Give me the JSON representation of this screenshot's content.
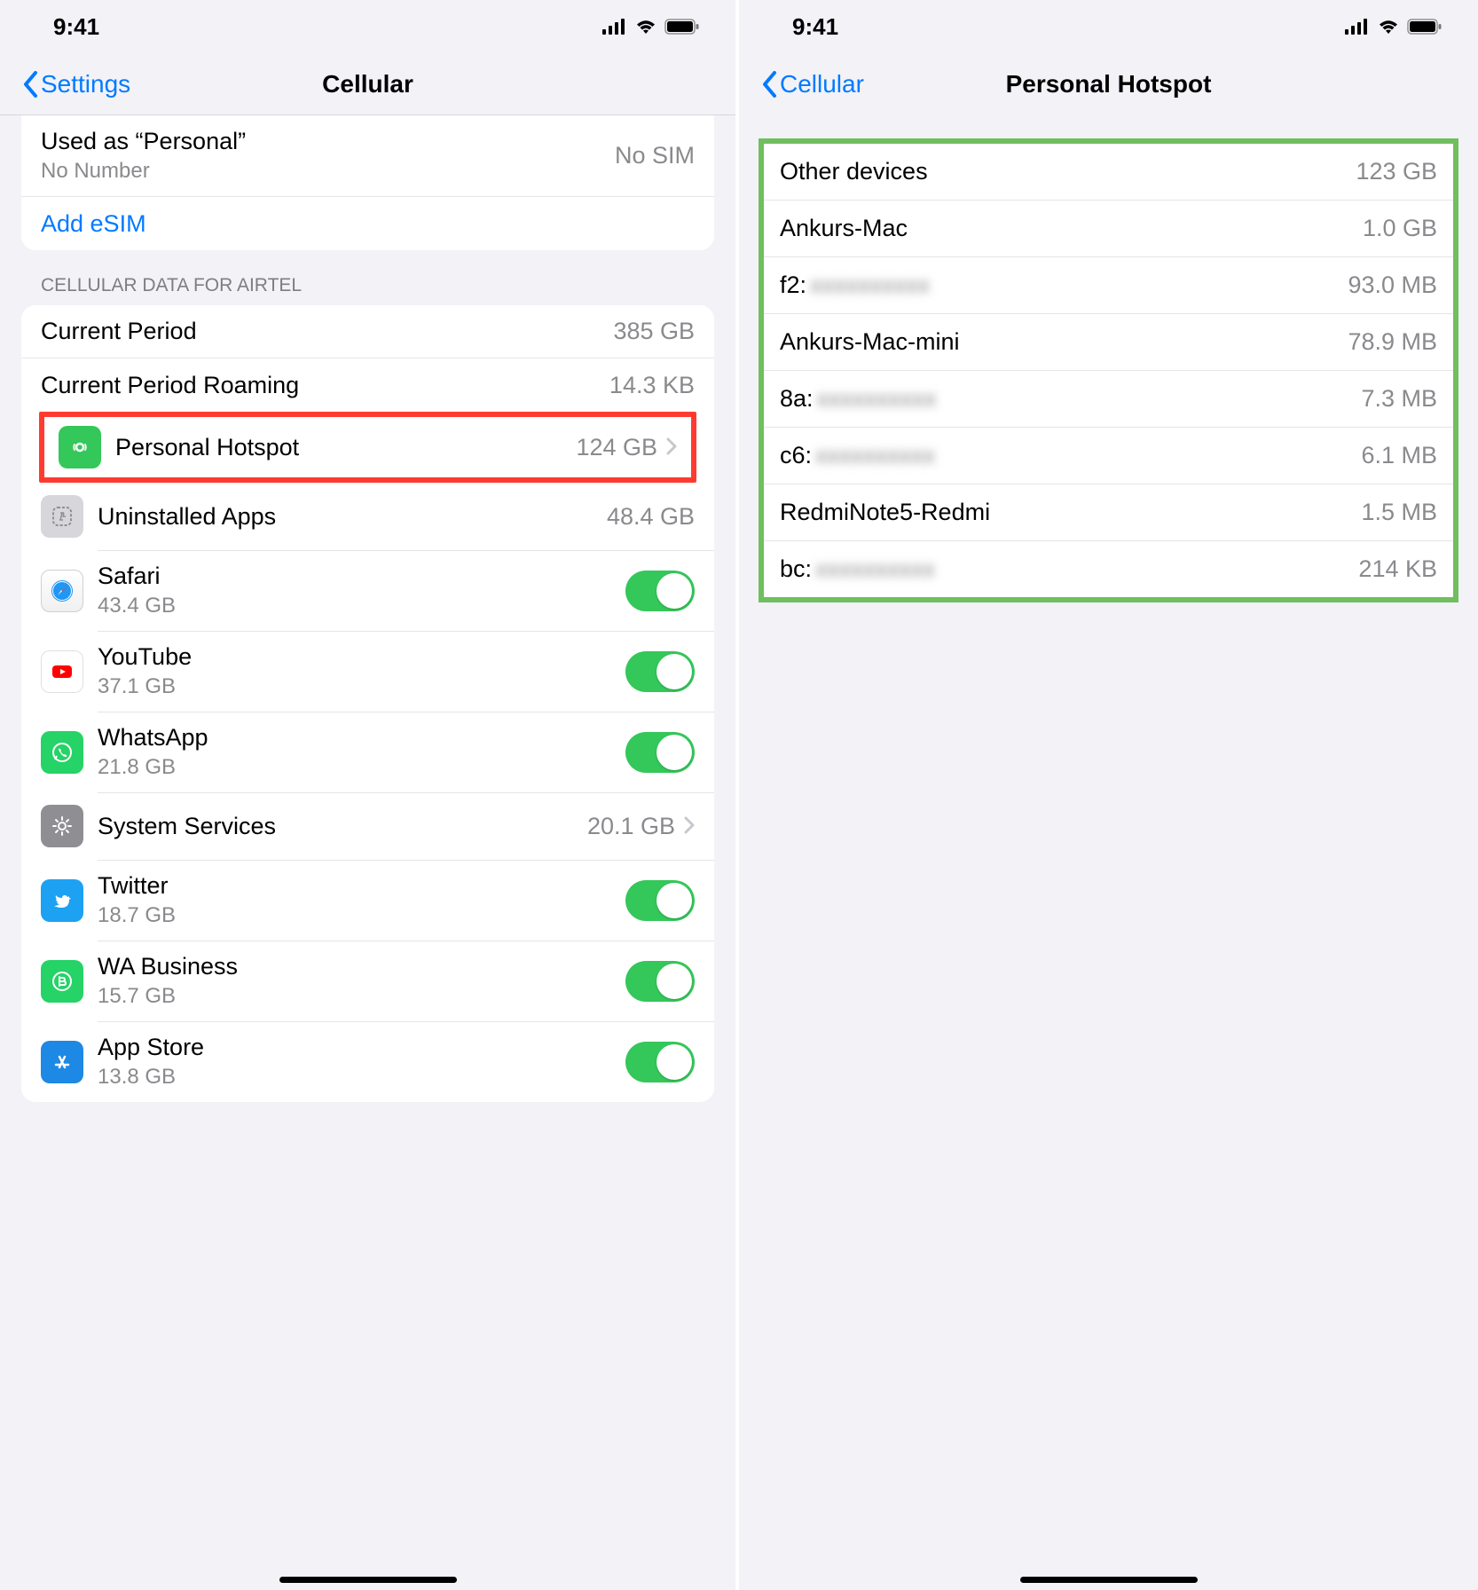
{
  "statusBar": {
    "time": "9:41"
  },
  "left": {
    "back": "Settings",
    "title": "Cellular",
    "sim": {
      "label": "Used as “Personal”",
      "sub": "No Number",
      "state": "No SIM",
      "addEsim": "Add eSIM"
    },
    "dataSectionHeader": "CELLULAR DATA FOR AIRTEL",
    "currentPeriod": {
      "label": "Current Period",
      "value": "385 GB"
    },
    "currentPeriodRoaming": {
      "label": "Current Period Roaming",
      "value": "14.3 KB"
    },
    "hotspot": {
      "label": "Personal Hotspot",
      "value": "124 GB"
    },
    "uninstalled": {
      "label": "Uninstalled Apps",
      "value": "48.4 GB"
    },
    "systemServices": {
      "label": "System Services",
      "value": "20.1 GB"
    },
    "apps": [
      {
        "name": "Safari",
        "usage": "43.4 GB",
        "iconClass": "ic-safari",
        "iconName": "safari-icon"
      },
      {
        "name": "YouTube",
        "usage": "37.1 GB",
        "iconClass": "ic-youtube",
        "iconName": "youtube-icon"
      },
      {
        "name": "WhatsApp",
        "usage": "21.8 GB",
        "iconClass": "ic-whatsapp",
        "iconName": "whatsapp-icon"
      },
      {
        "name": "__SYSTEM_SERVICES__",
        "usage": "",
        "iconClass": "",
        "iconName": ""
      },
      {
        "name": "Twitter",
        "usage": "18.7 GB",
        "iconClass": "ic-twitter",
        "iconName": "twitter-icon"
      },
      {
        "name": "WA Business",
        "usage": "15.7 GB",
        "iconClass": "ic-wa-business",
        "iconName": "wa-business-icon"
      },
      {
        "name": "App Store",
        "usage": "13.8 GB",
        "iconClass": "ic-appstore",
        "iconName": "appstore-icon"
      }
    ]
  },
  "right": {
    "back": "Cellular",
    "title": "Personal Hotspot",
    "devices": [
      {
        "name": "Other devices",
        "redacted": "",
        "usage": "123 GB"
      },
      {
        "name": "Ankurs-Mac",
        "redacted": "",
        "usage": "1.0 GB"
      },
      {
        "name": "f2:",
        "redacted": "xxxxxxxxxx",
        "usage": "93.0 MB"
      },
      {
        "name": "Ankurs-Mac-mini",
        "redacted": "",
        "usage": "78.9 MB"
      },
      {
        "name": "8a:",
        "redacted": "xxxxxxxxxx",
        "usage": "7.3 MB"
      },
      {
        "name": "c6:",
        "redacted": "xxxxxxxxxx",
        "usage": "6.1 MB"
      },
      {
        "name": "RedmiNote5-Redmi",
        "redacted": "",
        "usage": "1.5 MB"
      },
      {
        "name": "bc:",
        "redacted": "xxxxxxxxxx",
        "usage": "214 KB"
      }
    ]
  }
}
